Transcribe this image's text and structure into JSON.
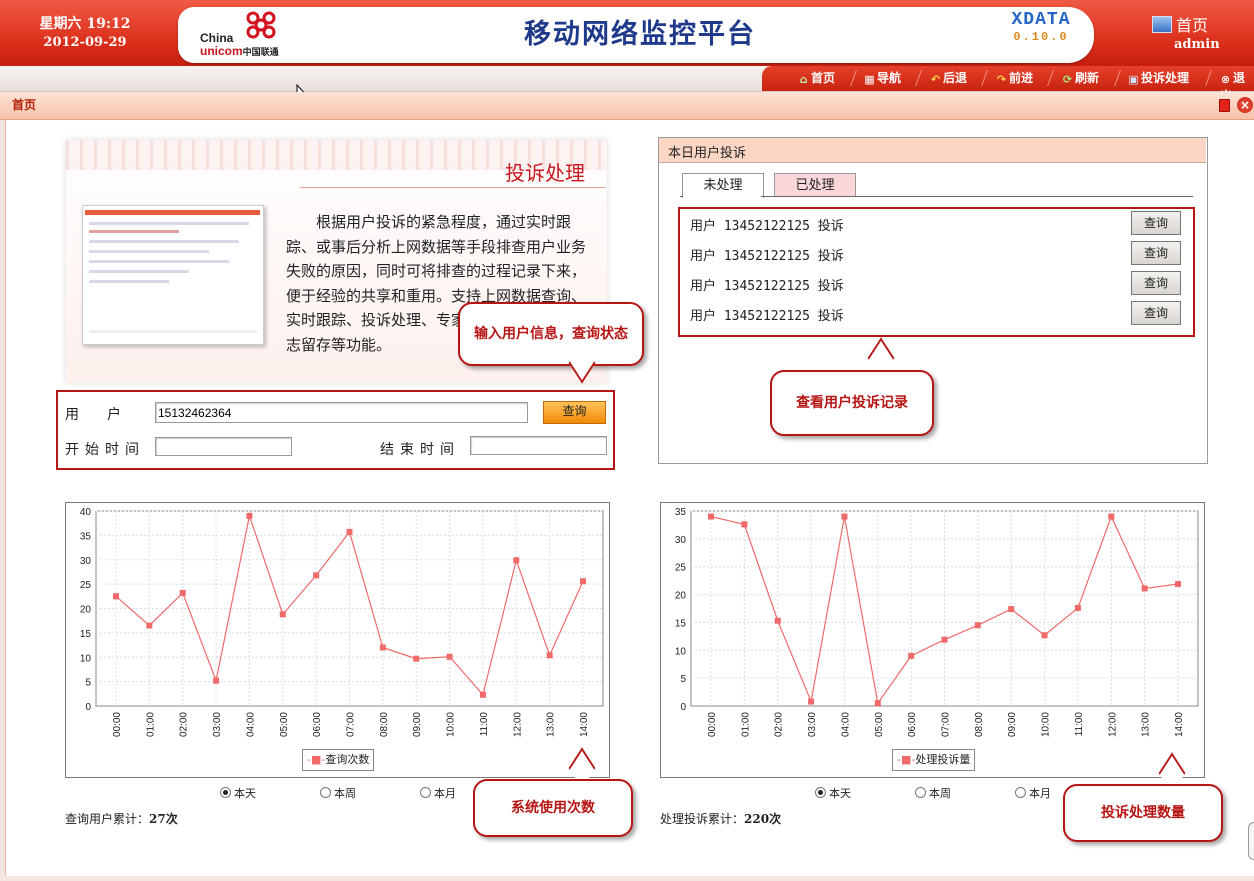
{
  "header": {
    "weekday_time": "星期六  19:12",
    "date": "2012-09-29",
    "logo_en_1": "China",
    "logo_en_2": "unicom",
    "logo_cn": "中国联通",
    "title": "移动网络监控平台",
    "brand": "XDATA",
    "version": "0.10.0",
    "home_label": "首页",
    "user": "admin"
  },
  "toolbar": {
    "home": "首页",
    "nav": "导航",
    "back": "后退",
    "forward": "前进",
    "refresh": "刷新",
    "complaint": "投诉处理",
    "exit": "退出"
  },
  "panel": {
    "title": "首页"
  },
  "intro": {
    "title": "投诉处理",
    "text": "根据用户投诉的紧急程度，通过实时跟踪、或事后分析上网数据等手段排查用户业务失败的原因，同时可将排查的过程记录下来，便于经验的共享和重用。支持上网数据查询、实时跟踪、投诉处理、专家处理辅助、上网日志留存等功能。"
  },
  "callouts": {
    "query": "输入用户信息，查询状态",
    "records": "查看用户投诉记录",
    "usage": "系统使用次数",
    "handled": "投诉处理数量"
  },
  "query": {
    "user_label": "用　　户",
    "user_value": "15132462364",
    "start_label": "开始时间",
    "end_label": "结束时间",
    "search_button": "查询"
  },
  "complaints": {
    "title": "本日用户投诉",
    "tab_pending": "未处理",
    "tab_done": "已处理",
    "rows": [
      {
        "text": "用户 13452122125 投诉",
        "button": "查询"
      },
      {
        "text": "用户 13452122125 投诉",
        "button": "查询"
      },
      {
        "text": "用户 13452122125 投诉",
        "button": "查询"
      },
      {
        "text": "用户 13452122125 投诉",
        "button": "查询"
      }
    ]
  },
  "radios": {
    "today": "本天",
    "week": "本周",
    "month": "本月"
  },
  "totals": {
    "query_label": "查询用户累计：",
    "query_value": "27次",
    "handled_label": "处理投诉累计：",
    "handled_value": "220次"
  },
  "chart_data": [
    {
      "type": "line",
      "categories": [
        "00:00",
        "01:00",
        "02:00",
        "03:00",
        "04:00",
        "05:00",
        "06:00",
        "07:00",
        "08:00",
        "09:00",
        "10:00",
        "11:00",
        "12:00",
        "13:00",
        "14:00"
      ],
      "series": [
        {
          "name": "查询次数",
          "values": [
            22.5,
            16.5,
            23.2,
            5.2,
            39,
            18.8,
            26.8,
            35.7,
            12,
            9.7,
            10.1,
            2.3,
            29.9,
            10.4,
            25.6
          ]
        }
      ],
      "ylim": [
        0,
        40
      ],
      "yticks": [
        0,
        5,
        10,
        15,
        20,
        25,
        30,
        35,
        40
      ],
      "grid": true,
      "legend": "bottom",
      "color": "#f06a6a"
    },
    {
      "type": "line",
      "categories": [
        "00:00",
        "01:00",
        "02:00",
        "03:00",
        "04:00",
        "05:00",
        "06:00",
        "07:00",
        "08:00",
        "09:00",
        "10:00",
        "11:00",
        "12:00",
        "13:00",
        "14:00"
      ],
      "series": [
        {
          "name": "处理投诉量",
          "values": [
            34,
            32.6,
            15.3,
            0.8,
            34,
            0.5,
            9,
            11.9,
            14.5,
            17.4,
            12.7,
            17.6,
            34,
            21.1,
            21.9
          ]
        }
      ],
      "ylim": [
        0,
        35
      ],
      "yticks": [
        0,
        5,
        10,
        15,
        20,
        25,
        30,
        35
      ],
      "grid": true,
      "legend": "bottom",
      "color": "#f06a6a"
    }
  ]
}
